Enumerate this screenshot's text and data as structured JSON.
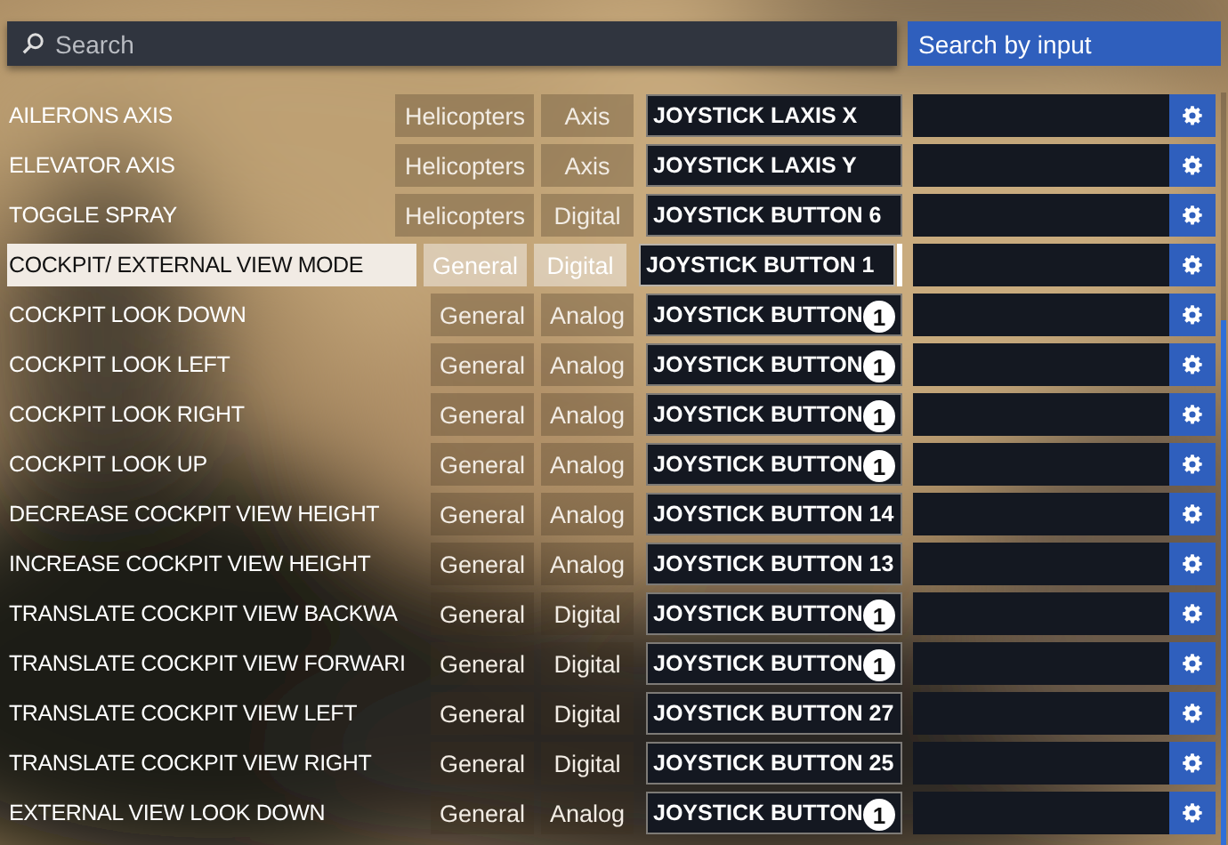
{
  "search": {
    "placeholder": "Search"
  },
  "search_by_input": {
    "label": "Search by input"
  },
  "rows": [
    {
      "name": "AILERONS AXIS",
      "category": "Helicopters",
      "type": "Axis",
      "binding": "JOYSTICK LAXIS X",
      "selected": false
    },
    {
      "name": "ELEVATOR AXIS",
      "category": "Helicopters",
      "type": "Axis",
      "binding": "JOYSTICK LAXIS Y",
      "selected": false
    },
    {
      "name": "TOGGLE SPRAY",
      "category": "Helicopters",
      "type": "Digital",
      "binding": "JOYSTICK BUTTON 6",
      "selected": false
    },
    {
      "name": "COCKPIT/ EXTERNAL VIEW MODE",
      "category": "General",
      "type": "Digital",
      "binding": "JOYSTICK BUTTON 1",
      "selected": true
    },
    {
      "name": "COCKPIT LOOK DOWN",
      "category": "General",
      "type": "Analog",
      "binding": "JOYSTICK BUTTON",
      "badge": "1",
      "selected": false
    },
    {
      "name": "COCKPIT LOOK LEFT",
      "category": "General",
      "type": "Analog",
      "binding": "JOYSTICK BUTTON",
      "badge": "1",
      "selected": false
    },
    {
      "name": "COCKPIT LOOK RIGHT",
      "category": "General",
      "type": "Analog",
      "binding": "JOYSTICK BUTTON",
      "badge": "1",
      "selected": false
    },
    {
      "name": "COCKPIT LOOK UP",
      "category": "General",
      "type": "Analog",
      "binding": "JOYSTICK BUTTON",
      "badge": "1",
      "selected": false
    },
    {
      "name": "DECREASE COCKPIT VIEW HEIGHT",
      "category": "General",
      "type": "Analog",
      "binding": "JOYSTICK BUTTON 14",
      "selected": false
    },
    {
      "name": "INCREASE COCKPIT VIEW HEIGHT",
      "category": "General",
      "type": "Analog",
      "binding": "JOYSTICK BUTTON 13",
      "selected": false
    },
    {
      "name": "TRANSLATE COCKPIT VIEW BACKWA",
      "category": "General",
      "type": "Digital",
      "binding": "JOYSTICK BUTTON",
      "badge": "1",
      "selected": false
    },
    {
      "name": "TRANSLATE COCKPIT VIEW FORWARI",
      "category": "General",
      "type": "Digital",
      "binding": "JOYSTICK BUTTON",
      "badge": "1",
      "selected": false
    },
    {
      "name": "TRANSLATE COCKPIT VIEW LEFT",
      "category": "General",
      "type": "Digital",
      "binding": "JOYSTICK BUTTON 27",
      "selected": false
    },
    {
      "name": "TRANSLATE COCKPIT VIEW RIGHT",
      "category": "General",
      "type": "Digital",
      "binding": "JOYSTICK BUTTON 25",
      "selected": false
    },
    {
      "name": "EXTERNAL VIEW LOOK DOWN",
      "category": "General",
      "type": "Analog",
      "binding": "JOYSTICK BUTTON",
      "badge": "1",
      "selected": false
    }
  ]
}
